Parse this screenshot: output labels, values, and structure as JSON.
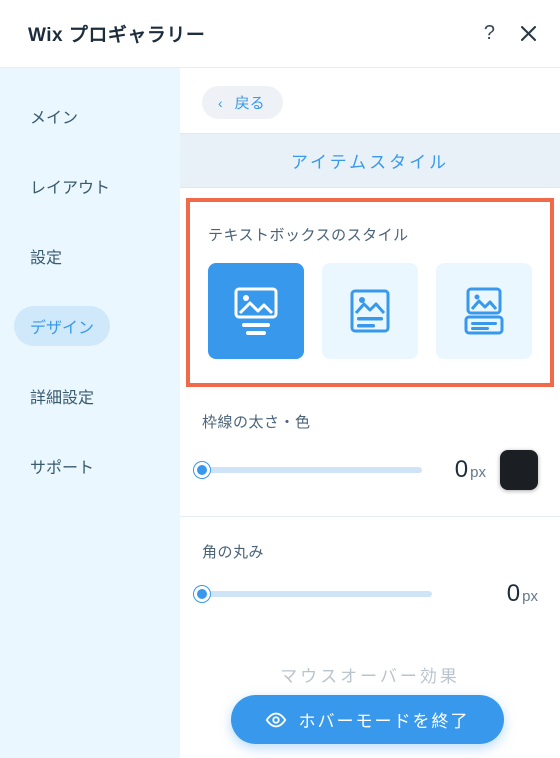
{
  "header": {
    "title": "Wix プロギャラリー"
  },
  "sidebar": {
    "items": [
      {
        "label": "メイン"
      },
      {
        "label": "レイアウト"
      },
      {
        "label": "設定"
      },
      {
        "label": "デザイン",
        "active": true
      },
      {
        "label": "詳細設定"
      },
      {
        "label": "サポート"
      }
    ]
  },
  "main": {
    "back_label": "戻る",
    "section_title": "アイテムスタイル",
    "textbox_style_label": "テキストボックスのスタイル",
    "border": {
      "label": "枠線の太さ・色",
      "value": "0",
      "unit": "px",
      "color": "#1b1e22"
    },
    "radius": {
      "label": "角の丸み",
      "value": "0",
      "unit": "px"
    },
    "next_section_title": "マウスオーバー効果",
    "hover_exit_label": "ホバーモードを終了"
  }
}
